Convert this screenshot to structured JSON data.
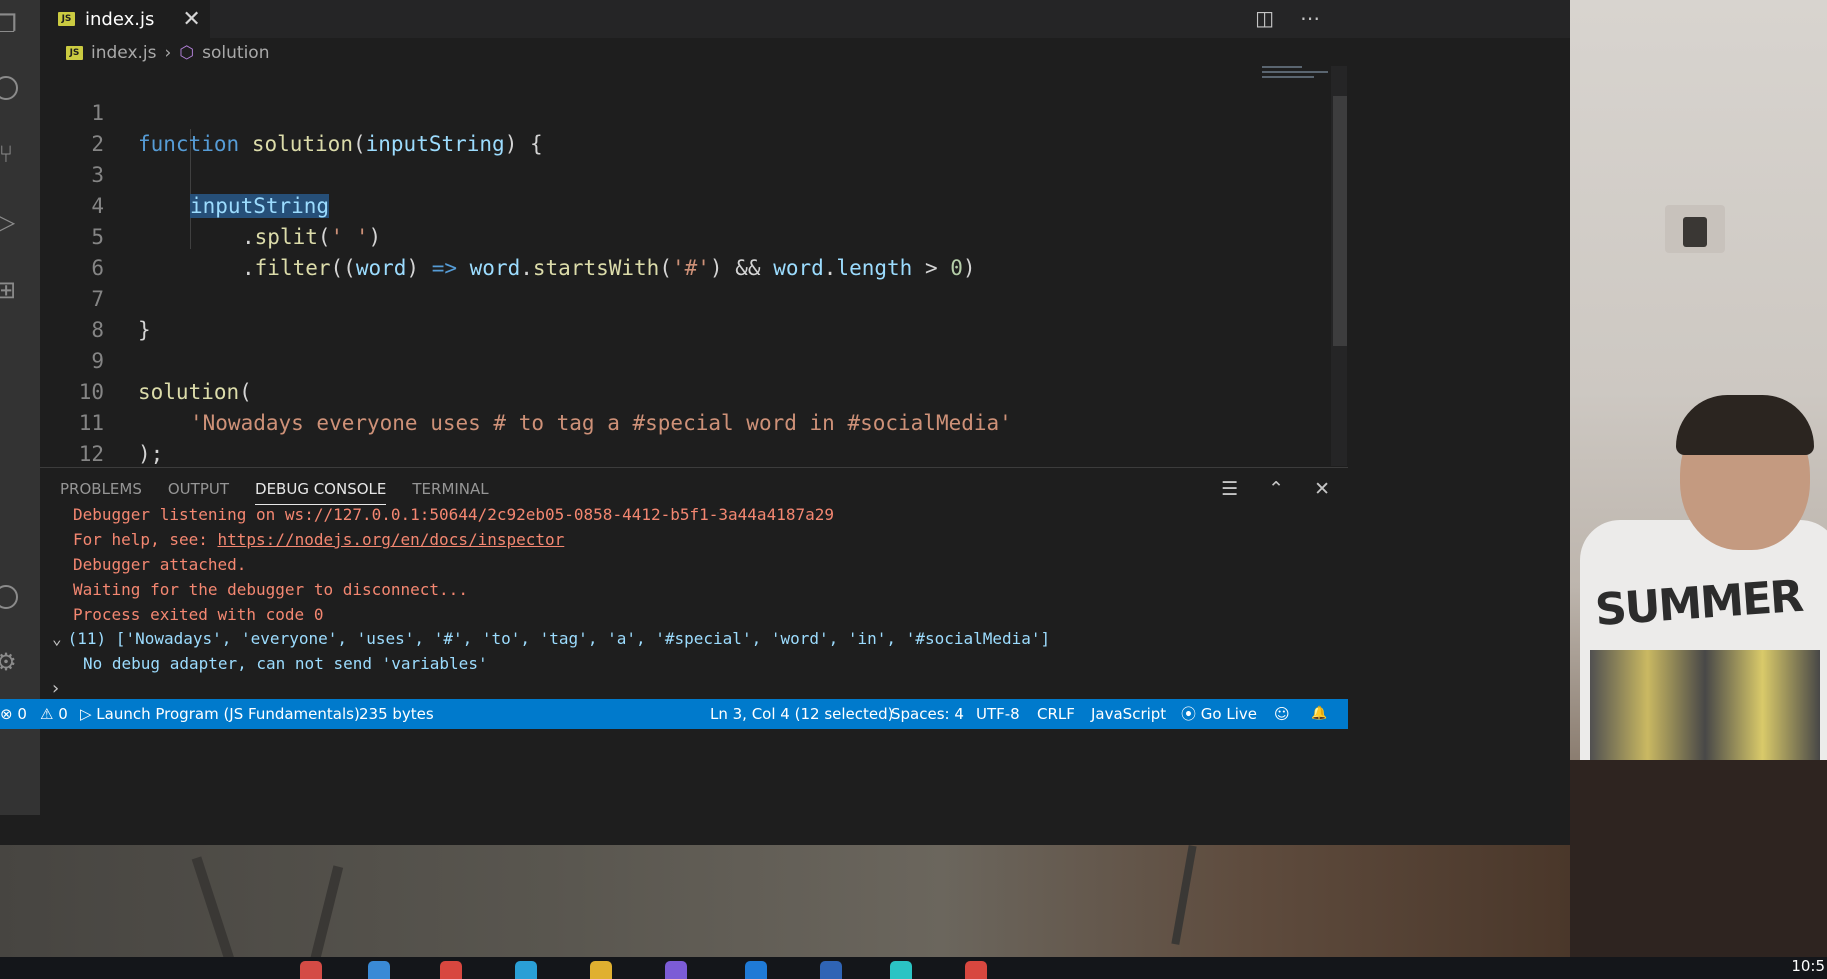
{
  "tab": {
    "badge": "JS",
    "label": "index.js",
    "close": "✕"
  },
  "tab_actions": {
    "split": "◫",
    "more": "⋯"
  },
  "breadcrumb": {
    "badge": "JS",
    "file": "index.js",
    "sep": "›",
    "cube": "⬡",
    "symbol": "solution"
  },
  "code": {
    "line_numbers": [
      "1",
      "2",
      "3",
      "4",
      "5",
      "6",
      "7",
      "8",
      "9",
      "10",
      "11",
      "12"
    ],
    "l1": {
      "kw": "function",
      "fn": "solution",
      "open": "(",
      "param": "inputString",
      "close": ") {"
    },
    "l3": {
      "selected": "inputString"
    },
    "l4": {
      "dot": ".",
      "fn": "split",
      "open": "(",
      "str": "' '",
      "close": ")"
    },
    "l5": {
      "dot": ".",
      "fn": "filter",
      "open": "((",
      "param": "word",
      "close1": ")",
      "arrow": "=>",
      "obj": "word",
      "dot2": ".",
      "fn2": "startsWith",
      "open2": "(",
      "str": "'#'",
      "close2": ")",
      "and": "&&",
      "obj2": "word",
      "dot3": ".",
      "prop": "length",
      "gt": ">",
      "num": "0",
      "close3": ")"
    },
    "l7": "}",
    "l9": {
      "fn": "solution",
      "open": "("
    },
    "l10": {
      "str": "'Nowadays everyone uses # to tag a #special word in #socialMedia'"
    },
    "l11": ");"
  },
  "panel": {
    "tabs": [
      "PROBLEMS",
      "OUTPUT",
      "DEBUG CONSOLE",
      "TERMINAL"
    ],
    "actions": {
      "clear": "☰",
      "maximize": "⌃",
      "close": "✕"
    },
    "console": {
      "l0": "Debugger listening on ws://127.0.0.1:50644/2c92eb05-0858-4412-b5f1-3a44a4187a29",
      "l1_prefix": "For help, see: ",
      "l1_link": "https://nodejs.org/en/docs/inspector",
      "l2": "Debugger attached.",
      "l3": "Waiting for the debugger to disconnect...",
      "l4": "Process exited with code 0",
      "l5_chevron": "⌄",
      "l5": "(11) ['Nowadays', 'everyone', 'uses', '#', 'to', 'tag', 'a', '#special', 'word', 'in', '#socialMedia']",
      "l6": "No debug adapter, can not send 'variables'",
      "prompt": "›"
    }
  },
  "status": {
    "errors": "⊗ 0",
    "warnings": "⚠ 0",
    "launch": "▷ Launch Program (JS Fundamentals)",
    "size": "235 bytes",
    "position": "Ln 3, Col 4 (12 selected)",
    "spaces": "Spaces: 4",
    "encoding": "UTF-8",
    "eol": "CRLF",
    "language": "JavaScript",
    "golive": "⦿ Go Live",
    "feedback": "☺",
    "bell": "🔔"
  },
  "taskbar": {
    "clock": "10:5"
  },
  "webcam": {
    "shirt_text": "SUMMER"
  },
  "colors": {
    "status_bar": "#007acc",
    "selection": "#264f78",
    "keyword": "#569cd6",
    "function": "#dcdcaa",
    "string": "#ce9178",
    "error_text": "#f48771"
  }
}
